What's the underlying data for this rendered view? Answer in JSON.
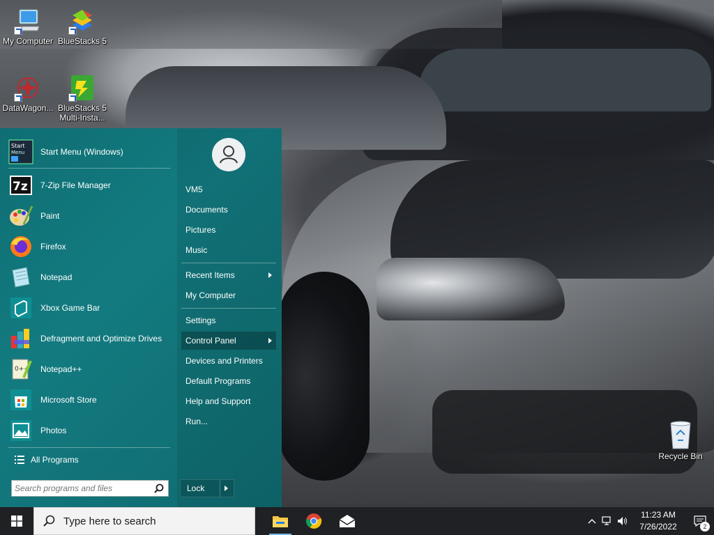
{
  "desktop": {
    "icons": [
      {
        "label": "My Computer",
        "icon": "computer-icon"
      },
      {
        "label": "BlueStacks 5",
        "icon": "bluestacks-icon"
      },
      {
        "label": "DataWagon...",
        "icon": "datawagon-icon"
      },
      {
        "label": "BlueStacks 5 Multi-Insta...",
        "icon": "bluestacks-multi-icon"
      },
      {
        "label": "Recycle Bin",
        "icon": "recycle-bin-icon"
      }
    ]
  },
  "start_menu": {
    "header": {
      "label": "Start Menu (Windows)",
      "icon": "start-menu-icon"
    },
    "apps": [
      {
        "label": "7-Zip File Manager",
        "icon": "7zip-icon"
      },
      {
        "label": "Paint",
        "icon": "paint-icon"
      },
      {
        "label": "Firefox",
        "icon": "firefox-icon"
      },
      {
        "label": "Notepad",
        "icon": "notepad-icon"
      },
      {
        "label": "Xbox Game Bar",
        "icon": "xbox-game-bar-icon"
      },
      {
        "label": "Defragment and Optimize Drives",
        "icon": "defrag-icon"
      },
      {
        "label": "Notepad++",
        "icon": "notepadpp-icon"
      },
      {
        "label": "Microsoft Store",
        "icon": "microsoft-store-icon"
      },
      {
        "label": "Photos",
        "icon": "photos-icon"
      }
    ],
    "all_programs": "All Programs",
    "search_placeholder": "Search programs and files",
    "right": {
      "user": "VM5",
      "documents": "Documents",
      "pictures": "Pictures",
      "music": "Music",
      "recent_items": "Recent Items",
      "my_computer": "My Computer",
      "settings": "Settings",
      "control_panel": "Control Panel",
      "devices_printers": "Devices and Printers",
      "default_programs": "Default Programs",
      "help_support": "Help and Support",
      "run": "Run..."
    },
    "lock_label": "Lock"
  },
  "taskbar": {
    "search_text": "Type here to search",
    "time": "11:23 AM",
    "date": "7/26/2022",
    "notification_count": "2"
  },
  "colors": {
    "menu_bg": "#137b80",
    "taskbar_bg": "#1f2124"
  }
}
